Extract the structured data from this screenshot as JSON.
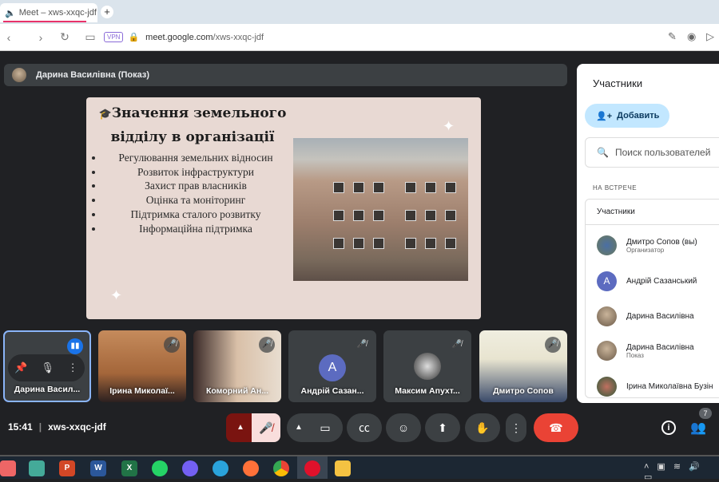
{
  "browser": {
    "tab_title": "Meet – xws-xxqc-jdf",
    "new_tab": "+",
    "vpn": "VPN",
    "url_host": "meet.google.com",
    "url_path": "/xws-xxqc-jdf"
  },
  "presenter": {
    "label": "Дарина Василівна (Показ)"
  },
  "slide": {
    "title": "Значення земельного відділу в організації",
    "bullets": [
      "Регулювання земельних відносин",
      "Розвиток інфраструктури",
      "Захист прав власників",
      "Оцінка та моніторинг",
      "Підтримка сталого розвитку",
      "Інформаційна підтримка"
    ]
  },
  "panel": {
    "title": "Участники",
    "add": "Добавить",
    "search_placeholder": "Поиск пользователей",
    "section": "НА ВСТРЕЧЕ",
    "group": "Участники",
    "people": [
      {
        "name": "Дмитро Сопов (вы)",
        "role": "Организатор"
      },
      {
        "name": "Андрій Сазанський",
        "role": "",
        "initial": "А"
      },
      {
        "name": "Дарина Василівна",
        "role": ""
      },
      {
        "name": "Дарина Василівна",
        "role": "Показ"
      },
      {
        "name": "Ірина Миколаївна Бузін",
        "role": ""
      }
    ]
  },
  "tiles": [
    {
      "name": "Дарина Васил..."
    },
    {
      "name": "Ірина Миколаї..."
    },
    {
      "name": "Коморний Ан..."
    },
    {
      "name": "Андрій Сазан...",
      "initial": "А"
    },
    {
      "name": "Максим Апухт..."
    },
    {
      "name": "Дмитро Сопов"
    }
  ],
  "meeting": {
    "time": "15:41",
    "code": "xws-xxqc-jdf",
    "participant_count": "7"
  },
  "colors": {
    "accent": "#8ab4f8",
    "end_call": "#ea4335",
    "mic_off_bg": "#f9dedc"
  }
}
